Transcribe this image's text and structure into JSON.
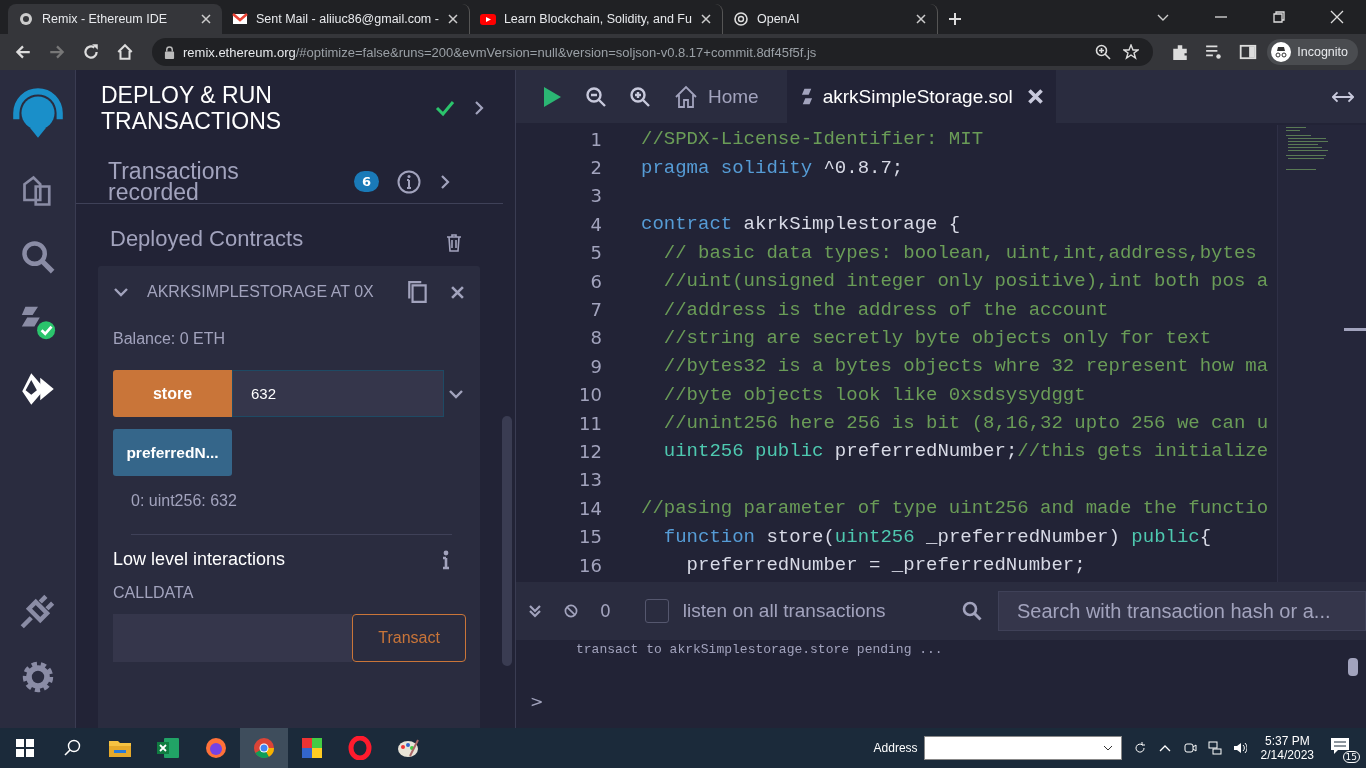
{
  "browser": {
    "tabs": [
      {
        "title": "Remix - Ethereum IDE",
        "kind": "remix",
        "selected": true
      },
      {
        "title": "Sent Mail - aliiuc86@gmail.com -",
        "kind": "mail",
        "selected": false
      },
      {
        "title": "Learn Blockchain, Solidity, and Fu",
        "kind": "video",
        "selected": false
      },
      {
        "title": "OpenAI",
        "kind": "openai",
        "selected": false
      }
    ],
    "url_host": "remix.ethereum.org",
    "url_path": "/#optimize=false&runs=200&evmVersion=null&version=soljson-v0.8.17+commit.8df45f5f.js",
    "profile": "Incognito"
  },
  "icon_bar": [
    {
      "kind": "files",
      "selected": false
    },
    {
      "kind": "search",
      "selected": false
    },
    {
      "kind": "compiler",
      "selected": false
    },
    {
      "kind": "deploy",
      "selected": true
    }
  ],
  "icon_bar_bottom": [
    {
      "kind": "plugin",
      "selected": false
    },
    {
      "kind": "settings",
      "selected": false
    }
  ],
  "panel": {
    "title": "DEPLOY & RUN TRANSACTIONS",
    "transactions_label": "Transactions recorded",
    "transactions_count": "6",
    "deployed_title": "Deployed Contracts",
    "contract": {
      "name": "AKRKSIMPLESTORAGE AT 0X",
      "expanded": true,
      "balance": "Balance: 0 ETH",
      "functions": [
        {
          "label": "store",
          "kind": "transact",
          "value": "632"
        },
        {
          "label": "preferredN...",
          "kind": "call"
        }
      ],
      "result": "0: uint256: 632",
      "low_level_title": "Low level interactions",
      "calldata_label": "CALLDATA",
      "transact_button": "Transact"
    }
  },
  "editor": {
    "tabs": [
      {
        "label": "Home",
        "kind": "home",
        "selected": false
      },
      {
        "label": "akrkSimpleStorage.sol",
        "kind": "file",
        "selected": true
      }
    ],
    "lines": [
      {
        "n": "1",
        "tokens": [
          {
            "t": "//SPDX-License-Identifier: MIT",
            "kind": "comment"
          }
        ]
      },
      {
        "n": "2",
        "tokens": [
          {
            "t": "pragma solidity",
            "kind": "keyword"
          },
          {
            "t": " ^0.8.7;",
            "kind": "plain"
          }
        ]
      },
      {
        "n": "3"
      },
      {
        "n": "4",
        "tokens": [
          {
            "t": "contract",
            "kind": "keyword"
          },
          {
            "t": " akrkSimplestorage {",
            "kind": "plain"
          }
        ]
      },
      {
        "n": "5",
        "tokens": [
          {
            "t": "  // basic data types: boolean, uint,int,address,bytes",
            "kind": "comment"
          }
        ]
      },
      {
        "n": "6",
        "tokens": [
          {
            "t": "  //uint(unsigned integer only positive),int both pos a",
            "kind": "comment"
          }
        ]
      },
      {
        "n": "7",
        "tokens": [
          {
            "t": "  //address is the address of the account",
            "kind": "comment"
          }
        ]
      },
      {
        "n": "8",
        "tokens": [
          {
            "t": "  //string are secretly byte objects only for text",
            "kind": "comment"
          }
        ]
      },
      {
        "n": "9",
        "tokens": [
          {
            "t": "  //bytes32 is a bytes objects whre 32 represent how ma",
            "kind": "comment"
          }
        ]
      },
      {
        "n": "10",
        "tokens": [
          {
            "t": "  //byte objects look like 0xsdsysydggt",
            "kind": "comment"
          }
        ]
      },
      {
        "n": "11",
        "tokens": [
          {
            "t": "  //unint256 here 256 is bit (8,16,32 upto 256 we can u",
            "kind": "comment"
          }
        ]
      },
      {
        "n": "12",
        "tokens": [
          {
            "t": "  uint256",
            "kind": "type"
          },
          {
            "t": " public",
            "kind": "type"
          },
          {
            "t": " preferredNumber;",
            "kind": "plain"
          },
          {
            "t": "//this gets initialize",
            "kind": "comment"
          }
        ]
      },
      {
        "n": "13"
      },
      {
        "n": "14",
        "tokens": [
          {
            "t": "//pasing parameter of type uint256 and made the functio",
            "kind": "comment"
          }
        ]
      },
      {
        "n": "15",
        "tokens": [
          {
            "t": "  function",
            "kind": "keyword"
          },
          {
            "t": " store(",
            "kind": "plain"
          },
          {
            "t": "uint256",
            "kind": "type"
          },
          {
            "t": " _preferredNumber) ",
            "kind": "plain"
          },
          {
            "t": "public",
            "kind": "type"
          },
          {
            "t": "{",
            "kind": "plain"
          }
        ]
      },
      {
        "n": "16",
        "tokens": [
          {
            "t": "    preferredNumber = _preferredNumber;",
            "kind": "plain"
          }
        ]
      }
    ]
  },
  "terminal": {
    "count": "0",
    "listen_label": "listen on all transactions",
    "listen_checked": false,
    "search_placeholder": "Search with transaction hash or a...",
    "log": "transact to akrkSimplestorage.store pending ...",
    "prompt": ">"
  },
  "taskbar": {
    "apps": [
      {
        "kind": "explorer",
        "selected": false
      },
      {
        "kind": "excel",
        "selected": false
      },
      {
        "kind": "firefox",
        "selected": false
      },
      {
        "kind": "chrome",
        "selected": true
      },
      {
        "kind": "tiles",
        "selected": false
      },
      {
        "kind": "opera",
        "selected": false
      },
      {
        "kind": "paint",
        "selected": false
      }
    ],
    "address_label": "Address",
    "time": "5:37 PM",
    "date": "2/14/2023",
    "notifications": "15"
  }
}
